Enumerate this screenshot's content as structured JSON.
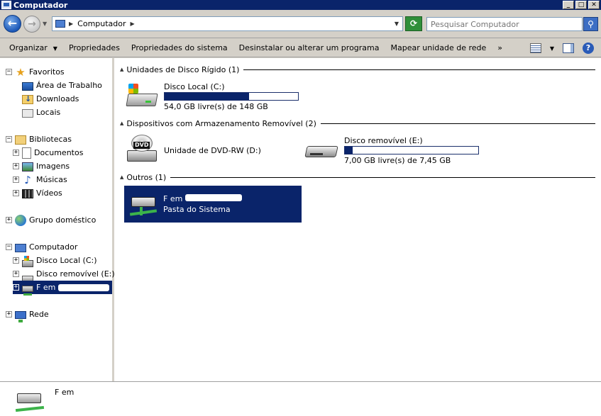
{
  "window": {
    "title": "Computador",
    "controls": {
      "minimize": "_",
      "maximize": "□",
      "close": "✕"
    }
  },
  "address_bar": {
    "breadcrumb": "Computador",
    "search_placeholder": "Pesquisar Computador",
    "icons": {
      "back": "arrow-left-icon",
      "forward": "arrow-right-icon",
      "refresh": "refresh-icon",
      "search": "magnifier-icon"
    }
  },
  "toolbar": {
    "organize": "Organizar",
    "properties": "Propriedades",
    "system_properties": "Propriedades do sistema",
    "uninstall": "Desinstalar ou alterar um programa",
    "map_drive": "Mapear unidade de rede",
    "more": "»"
  },
  "sidebar": {
    "favorites": {
      "label": "Favoritos",
      "items": [
        {
          "label": "Área de Trabalho",
          "icon": "desktop-icon"
        },
        {
          "label": "Downloads",
          "icon": "downloads-icon"
        },
        {
          "label": "Locais",
          "icon": "recent-places-icon"
        }
      ]
    },
    "libraries": {
      "label": "Bibliotecas",
      "items": [
        {
          "label": "Documentos",
          "icon": "documents-icon"
        },
        {
          "label": "Imagens",
          "icon": "pictures-icon"
        },
        {
          "label": "Músicas",
          "icon": "music-icon"
        },
        {
          "label": "Vídeos",
          "icon": "videos-icon"
        }
      ]
    },
    "homegroup": {
      "label": "Grupo doméstico"
    },
    "computer": {
      "label": "Computador",
      "items": [
        {
          "label": "Disco Local (C:)",
          "icon": "hard-drive-icon"
        },
        {
          "label": "Disco removível (E:)",
          "icon": "removable-drive-icon"
        },
        {
          "label": "F em",
          "icon": "network-drive-icon",
          "selected": true
        }
      ]
    },
    "network": {
      "label": "Rede"
    }
  },
  "main": {
    "groups": [
      {
        "title": "Unidades de Disco Rígido (1)",
        "items": [
          {
            "name": "Disco Local (C:)",
            "free_text": "54,0 GB livre(s) de 148 GB",
            "used_fraction": 0.635
          }
        ]
      },
      {
        "title": "Dispositivos com Armazenamento Removível (2)",
        "items": [
          {
            "name": "Unidade de DVD-RW (D:)",
            "icon_label": "DVD"
          },
          {
            "name": "Disco removível (E:)",
            "free_text": "7,00 GB livre(s) de 7,45 GB",
            "used_fraction": 0.06
          }
        ]
      },
      {
        "title": "Outros (1)",
        "items": [
          {
            "name": "F em",
            "subtitle": "Pasta do Sistema",
            "selected": true
          }
        ]
      }
    ]
  },
  "details": {
    "name": "F em"
  },
  "colors": {
    "selection": "#0a246a",
    "chrome": "#d4d0c8",
    "window_title": "#0a246a"
  }
}
